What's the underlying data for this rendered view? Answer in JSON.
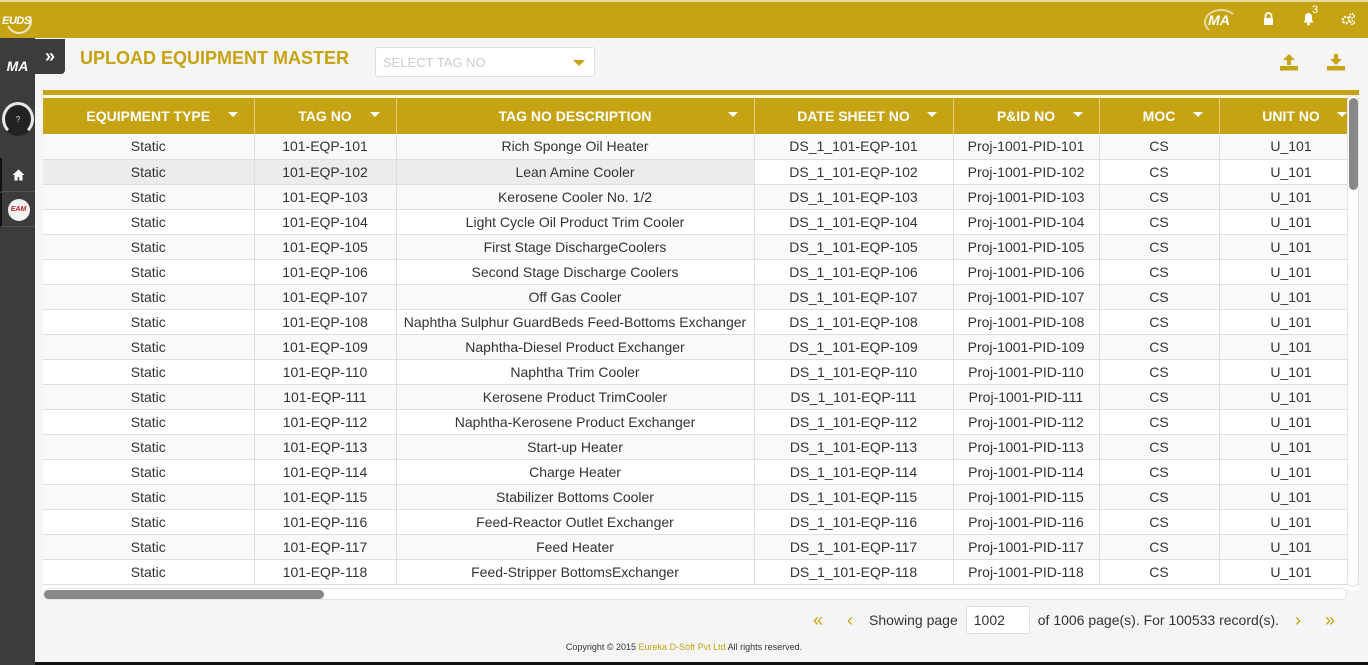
{
  "app": {
    "brand_logo": "EUDS",
    "module_logo": "MA",
    "notification_count": "3"
  },
  "topbar": {
    "icons": [
      "ma-logo",
      "lock-icon",
      "bell-icon",
      "settings-cogs-icon"
    ]
  },
  "sidebar": {
    "logo": "MA",
    "avatar_label": "?",
    "items": [
      {
        "name": "home",
        "icon": "home-icon"
      },
      {
        "name": "eam",
        "label": "EAM"
      }
    ],
    "expand_glyph": "»"
  },
  "header": {
    "title": "UPLOAD EQUIPMENT MASTER",
    "tag_select": {
      "placeholder": "SELECT TAG NO",
      "value": ""
    },
    "actions": [
      {
        "name": "upload",
        "icon": "upload-icon"
      },
      {
        "name": "download",
        "icon": "download-icon"
      }
    ]
  },
  "colors": {
    "accent": "#c6a312",
    "sidebar": "#3c3c3c"
  },
  "table": {
    "columns": [
      "EQUIPMENT TYPE",
      "TAG NO",
      "TAG NO DESCRIPTION",
      "DATE SHEET NO",
      "P&ID NO",
      "MOC",
      "UNIT NO"
    ],
    "rows": [
      [
        "Static",
        "101-EQP-101",
        "Rich Sponge Oil Heater",
        "DS_1_101-EQP-101",
        "Proj-1001-PID-101",
        "CS",
        "U_101"
      ],
      [
        "Static",
        "101-EQP-102",
        "Lean Amine Cooler",
        "DS_1_101-EQP-102",
        "Proj-1001-PID-102",
        "CS",
        "U_101"
      ],
      [
        "Static",
        "101-EQP-103",
        "Kerosene Cooler No. 1/2",
        "DS_1_101-EQP-103",
        "Proj-1001-PID-103",
        "CS",
        "U_101"
      ],
      [
        "Static",
        "101-EQP-104",
        "Light Cycle Oil Product Trim Cooler",
        "DS_1_101-EQP-104",
        "Proj-1001-PID-104",
        "CS",
        "U_101"
      ],
      [
        "Static",
        "101-EQP-105",
        "First Stage DischargeCoolers",
        "DS_1_101-EQP-105",
        "Proj-1001-PID-105",
        "CS",
        "U_101"
      ],
      [
        "Static",
        "101-EQP-106",
        "Second Stage Discharge Coolers",
        "DS_1_101-EQP-106",
        "Proj-1001-PID-106",
        "CS",
        "U_101"
      ],
      [
        "Static",
        "101-EQP-107",
        "Off Gas Cooler",
        "DS_1_101-EQP-107",
        "Proj-1001-PID-107",
        "CS",
        "U_101"
      ],
      [
        "Static",
        "101-EQP-108",
        "Naphtha Sulphur GuardBeds Feed-Bottoms Exchanger",
        "DS_1_101-EQP-108",
        "Proj-1001-PID-108",
        "CS",
        "U_101"
      ],
      [
        "Static",
        "101-EQP-109",
        "Naphtha-Diesel Product Exchanger",
        "DS_1_101-EQP-109",
        "Proj-1001-PID-109",
        "CS",
        "U_101"
      ],
      [
        "Static",
        "101-EQP-110",
        "Naphtha Trim Cooler",
        "DS_1_101-EQP-110",
        "Proj-1001-PID-110",
        "CS",
        "U_101"
      ],
      [
        "Static",
        "101-EQP-111",
        "Kerosene Product TrimCooler",
        "DS_1_101-EQP-111",
        "Proj-1001-PID-111",
        "CS",
        "U_101"
      ],
      [
        "Static",
        "101-EQP-112",
        "Naphtha-Kerosene Product Exchanger",
        "DS_1_101-EQP-112",
        "Proj-1001-PID-112",
        "CS",
        "U_101"
      ],
      [
        "Static",
        "101-EQP-113",
        "Start-up Heater",
        "DS_1_101-EQP-113",
        "Proj-1001-PID-113",
        "CS",
        "U_101"
      ],
      [
        "Static",
        "101-EQP-114",
        "Charge Heater",
        "DS_1_101-EQP-114",
        "Proj-1001-PID-114",
        "CS",
        "U_101"
      ],
      [
        "Static",
        "101-EQP-115",
        "Stabilizer Bottoms Cooler",
        "DS_1_101-EQP-115",
        "Proj-1001-PID-115",
        "CS",
        "U_101"
      ],
      [
        "Static",
        "101-EQP-116",
        "Feed-Reactor Outlet Exchanger",
        "DS_1_101-EQP-116",
        "Proj-1001-PID-116",
        "CS",
        "U_101"
      ],
      [
        "Static",
        "101-EQP-117",
        "Feed Heater",
        "DS_1_101-EQP-117",
        "Proj-1001-PID-117",
        "CS",
        "U_101"
      ],
      [
        "Static",
        "101-EQP-118",
        "Feed-Stripper BottomsExchanger",
        "DS_1_101-EQP-118",
        "Proj-1001-PID-118",
        "CS",
        "U_101"
      ]
    ]
  },
  "pagination": {
    "first": "«",
    "prev": "‹",
    "showing_label": "Showing page",
    "current_page": "1002",
    "summary": "of 1006 page(s). For 100533 record(s).",
    "next": "›",
    "last": "»"
  },
  "footer": {
    "prefix": "Copyright © 2015",
    "company": "Eureka D-Soft Pvt Ltd",
    "suffix": "All rights reserved."
  }
}
